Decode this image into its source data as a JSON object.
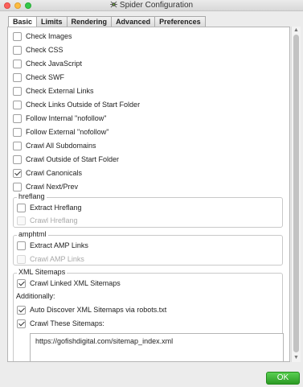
{
  "window": {
    "title": "Spider Configuration",
    "app_icon": "spider-icon"
  },
  "tabs": [
    {
      "label": "Basic",
      "active": true
    },
    {
      "label": "Limits",
      "active": false
    },
    {
      "label": "Rendering",
      "active": false
    },
    {
      "label": "Advanced",
      "active": false
    },
    {
      "label": "Preferences",
      "active": false
    }
  ],
  "basic": {
    "options": [
      {
        "label": "Check Images",
        "checked": false
      },
      {
        "label": "Check CSS",
        "checked": false
      },
      {
        "label": "Check JavaScript",
        "checked": false
      },
      {
        "label": "Check SWF",
        "checked": false
      },
      {
        "label": "Check External Links",
        "checked": false
      },
      {
        "label": "Check Links Outside of Start Folder",
        "checked": false
      },
      {
        "label": "Follow Internal \"nofollow\"",
        "checked": false
      },
      {
        "label": "Follow External \"nofollow\"",
        "checked": false
      },
      {
        "label": "Crawl All Subdomains",
        "checked": false
      },
      {
        "label": "Crawl Outside of Start Folder",
        "checked": false
      },
      {
        "label": "Crawl Canonicals",
        "checked": true
      },
      {
        "label": "Crawl Next/Prev",
        "checked": false
      }
    ],
    "hreflang": {
      "title": "hreflang",
      "extract": {
        "label": "Extract Hreflang",
        "checked": false
      },
      "crawl": {
        "label": "Crawl Hreflang",
        "checked": false,
        "disabled": true
      }
    },
    "amphtml": {
      "title": "amphtml",
      "extract": {
        "label": "Extract AMP Links",
        "checked": false
      },
      "crawl": {
        "label": "Crawl AMP Links",
        "checked": false,
        "disabled": true
      }
    },
    "xml_sitemaps": {
      "title": "XML Sitemaps",
      "crawl_linked": {
        "label": "Crawl Linked XML Sitemaps",
        "checked": true
      },
      "additionally_label": "Additionally:",
      "auto_discover": {
        "label": "Auto Discover XML Sitemaps via robots.txt",
        "checked": true
      },
      "crawl_these": {
        "label": "Crawl These Sitemaps:",
        "checked": true
      },
      "sitemap_urls": "https://gofishdigital.com/sitemap_index.xml"
    }
  },
  "footer": {
    "ok_label": "OK",
    "ok_color": "#3cb034"
  }
}
